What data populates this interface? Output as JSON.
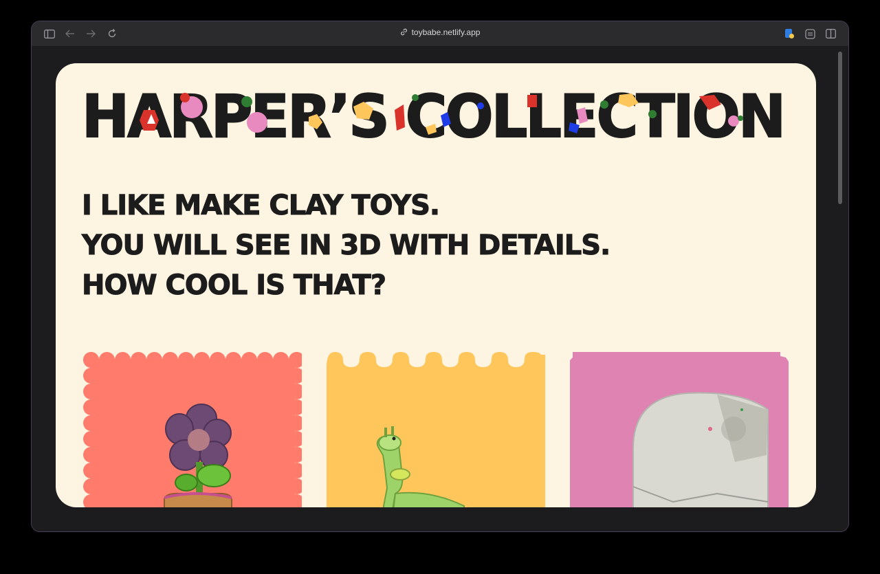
{
  "browser": {
    "url": "toybabe.netlify.app",
    "icons": [
      "sidebar-icon",
      "back-icon",
      "forward-icon",
      "reload-icon",
      "link-icon",
      "extension-icon",
      "reader-icon",
      "split-view-icon"
    ]
  },
  "page": {
    "title": "HARPER’S COLLECTION",
    "tagline": {
      "line1": "I LIKE MAKE CLAY TOYS.",
      "line2": "YOU WILL SEE IN 3D WITH DETAILS.",
      "line3": "HOW COOL IS THAT?"
    },
    "cards": [
      {
        "label": "flower toy",
        "bg": "#ff7b6b"
      },
      {
        "label": "giraffe toy",
        "bg": "#ffc65c"
      },
      {
        "label": "paper house toy",
        "bg": "#df84b2"
      }
    ]
  },
  "colors": {
    "background": "#fdf4e1",
    "text": "#1c1c1c",
    "red": "#d9332b",
    "green": "#2e7d32",
    "blue": "#1e3de6",
    "pink": "#e88ac0",
    "yellow": "#ffc65c",
    "orange": "#ee5a24"
  }
}
